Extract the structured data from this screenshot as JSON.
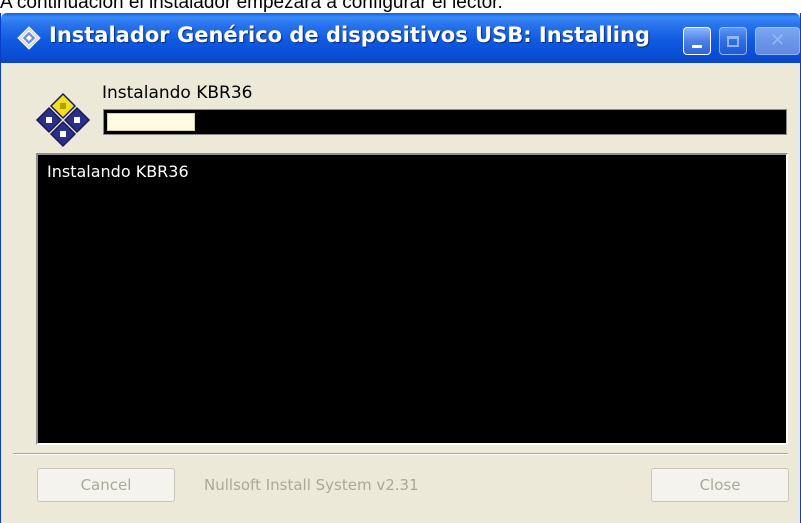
{
  "caption": "A continuación el instalador empezará a configurar el lector.",
  "window": {
    "title": "Instalador Genérico de dispositivos USB: Installing",
    "icon": "installer-diamond-icon",
    "controls": {
      "minimize": "minimize-icon",
      "maximize": "maximize-icon",
      "close": "close-icon"
    }
  },
  "header": {
    "icon": "usb-device-diamonds-icon",
    "status_text": "Instalando KBR36",
    "progress_fraction": 0.13
  },
  "log": {
    "lines": [
      "Instalando KBR36"
    ]
  },
  "footer": {
    "cancel_label": "Cancel",
    "branding": "Nullsoft Install System v2.31",
    "close_label": "Close"
  },
  "colors": {
    "titlebar": "#0b4fd8",
    "dialog_bg": "#ece9d8",
    "log_bg": "#000000",
    "progress_fill": "#fffbe0",
    "disabled_text": "#aca899"
  }
}
